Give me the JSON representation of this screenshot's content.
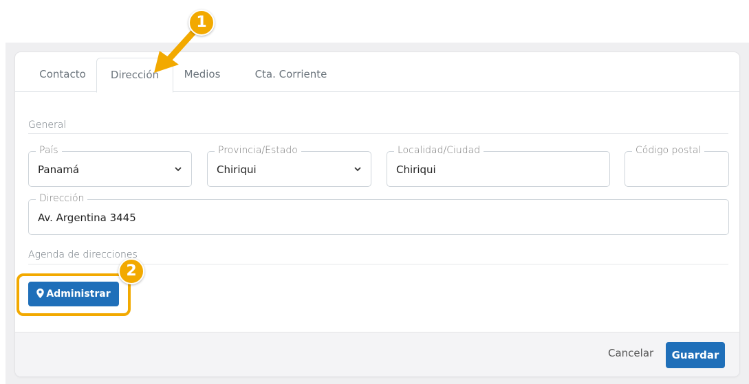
{
  "tabs": [
    {
      "label": "Contacto"
    },
    {
      "label": "Dirección"
    },
    {
      "label": "Medios"
    },
    {
      "label": "Cta. Corriente"
    }
  ],
  "sections": {
    "general": "General",
    "agenda": "Agenda de direcciones"
  },
  "fields": {
    "pais": {
      "label": "País",
      "value": "Panamá"
    },
    "provincia": {
      "label": "Provincia/Estado",
      "value": "Chiriqui"
    },
    "localidad": {
      "label": "Localidad/Ciudad",
      "value": "Chiriqui"
    },
    "codigo_postal": {
      "label": "Código postal",
      "value": ""
    },
    "direccion": {
      "label": "Dirección",
      "value": "Av. Argentina 3445"
    }
  },
  "buttons": {
    "administrar": "Administrar",
    "cancelar": "Cancelar",
    "guardar": "Guardar"
  },
  "annotations": {
    "marker1": "1",
    "marker2": "2",
    "color": "#f2a900"
  },
  "colors": {
    "primary": "#1f6fb9"
  }
}
